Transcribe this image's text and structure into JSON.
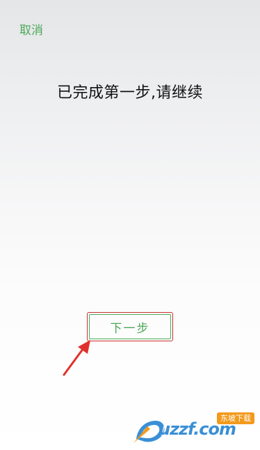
{
  "header": {
    "cancel_label": "取消"
  },
  "main": {
    "heading": "已完成第一步,请继续",
    "next_label": "下一步"
  },
  "watermark": {
    "text": "uzzf.com",
    "badge": "东坡下载"
  },
  "colors": {
    "accent": "#4ca85a",
    "annotation": "#c9302c"
  }
}
